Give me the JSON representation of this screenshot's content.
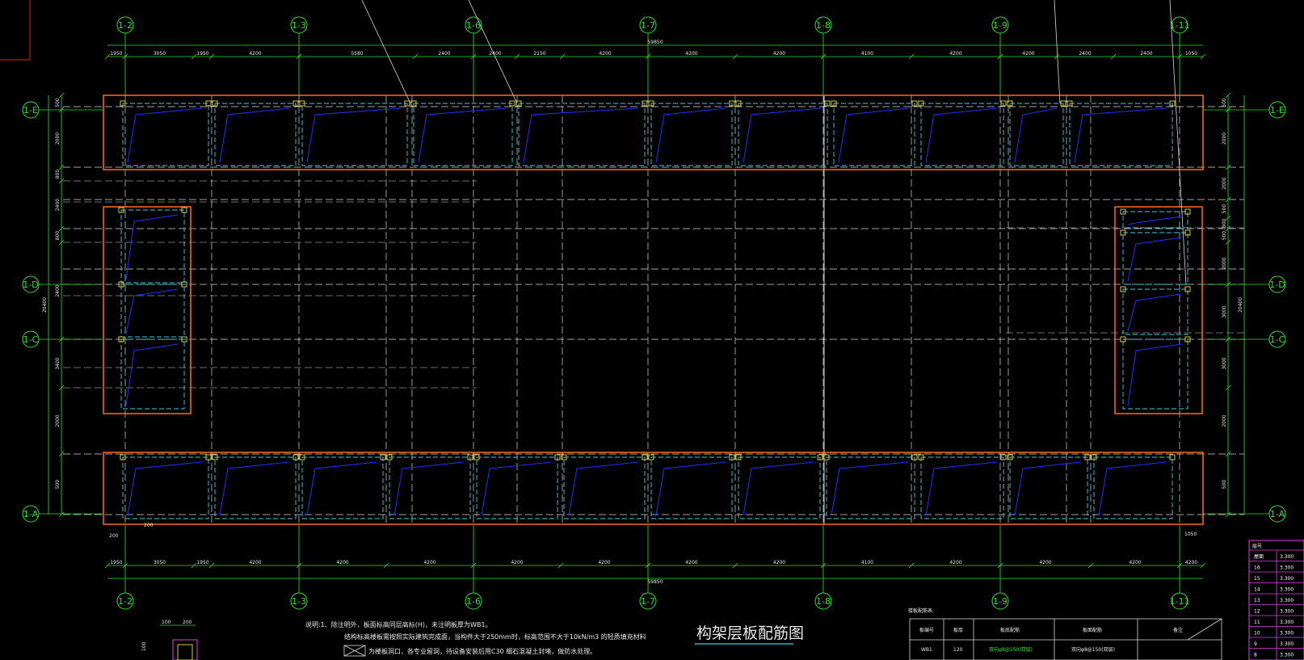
{
  "drawing": {
    "title": "构架层板配筋图",
    "axes_top": [
      "1-2",
      "1-3",
      "1-6",
      "1-7",
      "1-8",
      "1-9",
      "1-11"
    ],
    "axes_left": [
      "1-E",
      "1-D",
      "1-C",
      "1-A"
    ],
    "axes_right": [
      "1-E",
      "1-D",
      "1-C",
      "1-A"
    ],
    "overall_dim": "59850",
    "top_dims": [
      "1950",
      "3050",
      "1950",
      "4200",
      "5580",
      "2400",
      "2400",
      "2150",
      "4200",
      "4200",
      "4200",
      "4100",
      "4200",
      "4200",
      "2400",
      "2400",
      "1050"
    ],
    "bottom_dims": [
      "1950",
      "3050",
      "1950",
      "4200",
      "4200",
      "4200",
      "4200",
      "4200",
      "4200",
      "4200",
      "4100",
      "4200",
      "4200",
      "4200",
      "4200"
    ],
    "left_dims": [
      "500",
      "2000",
      "800",
      "2400",
      "800",
      "2400",
      "3400",
      "2000",
      "500"
    ],
    "right_dims": [
      "500",
      "2000",
      "2000",
      "500",
      "800",
      "500",
      "2000",
      "3000",
      "3000",
      "2000",
      "500"
    ],
    "left_total": "20400",
    "right_total": "20400",
    "misc_labels": [
      "200",
      "200",
      "1050"
    ],
    "notes": [
      "说明:1、除注明外，板面标高同层高标(H)，未注明板厚为WB1。",
      "结构标高楼板需按照实际建筑完成面，当构件大于250mm时，标高范围不大于10kN/m3 的轻质填充材料",
      "为楼板洞口，各专业留洞，待设备安装后用C30 细石混凝土封堵，做防水处理。"
    ],
    "detail_dims": [
      "100",
      "200",
      "100"
    ]
  },
  "slab_table": {
    "caption": "楼板配筋表:",
    "headers": [
      "板编号",
      "板厚",
      "板底配筋",
      "板面配筋",
      "备注"
    ],
    "rows": [
      [
        "WB1",
        "120",
        "双向φ8@150(双层)",
        "双向φ8@150(双层)",
        ""
      ]
    ]
  },
  "level_table": {
    "header": "层号",
    "rows": [
      [
        "屋面",
        "3.300"
      ],
      [
        "16",
        "3.300"
      ],
      [
        "15",
        "3.300"
      ],
      [
        "14",
        "3.300"
      ],
      [
        "13",
        "3.300"
      ],
      [
        "12",
        "3.300"
      ],
      [
        "11",
        "3.300"
      ],
      [
        "10",
        "3.300"
      ],
      [
        "9",
        "3.300"
      ],
      [
        "8",
        "3.300"
      ]
    ]
  },
  "colors": {
    "axis_green": "#2ee02e",
    "beam_orange": "#ff6a1a",
    "rebar_blue": "#2030ff",
    "rebar_cyan": "#36d0e8",
    "column_yellow": "#d6c83a",
    "grid_white": "#d8d8d8",
    "level_magenta": "#e040e0"
  }
}
